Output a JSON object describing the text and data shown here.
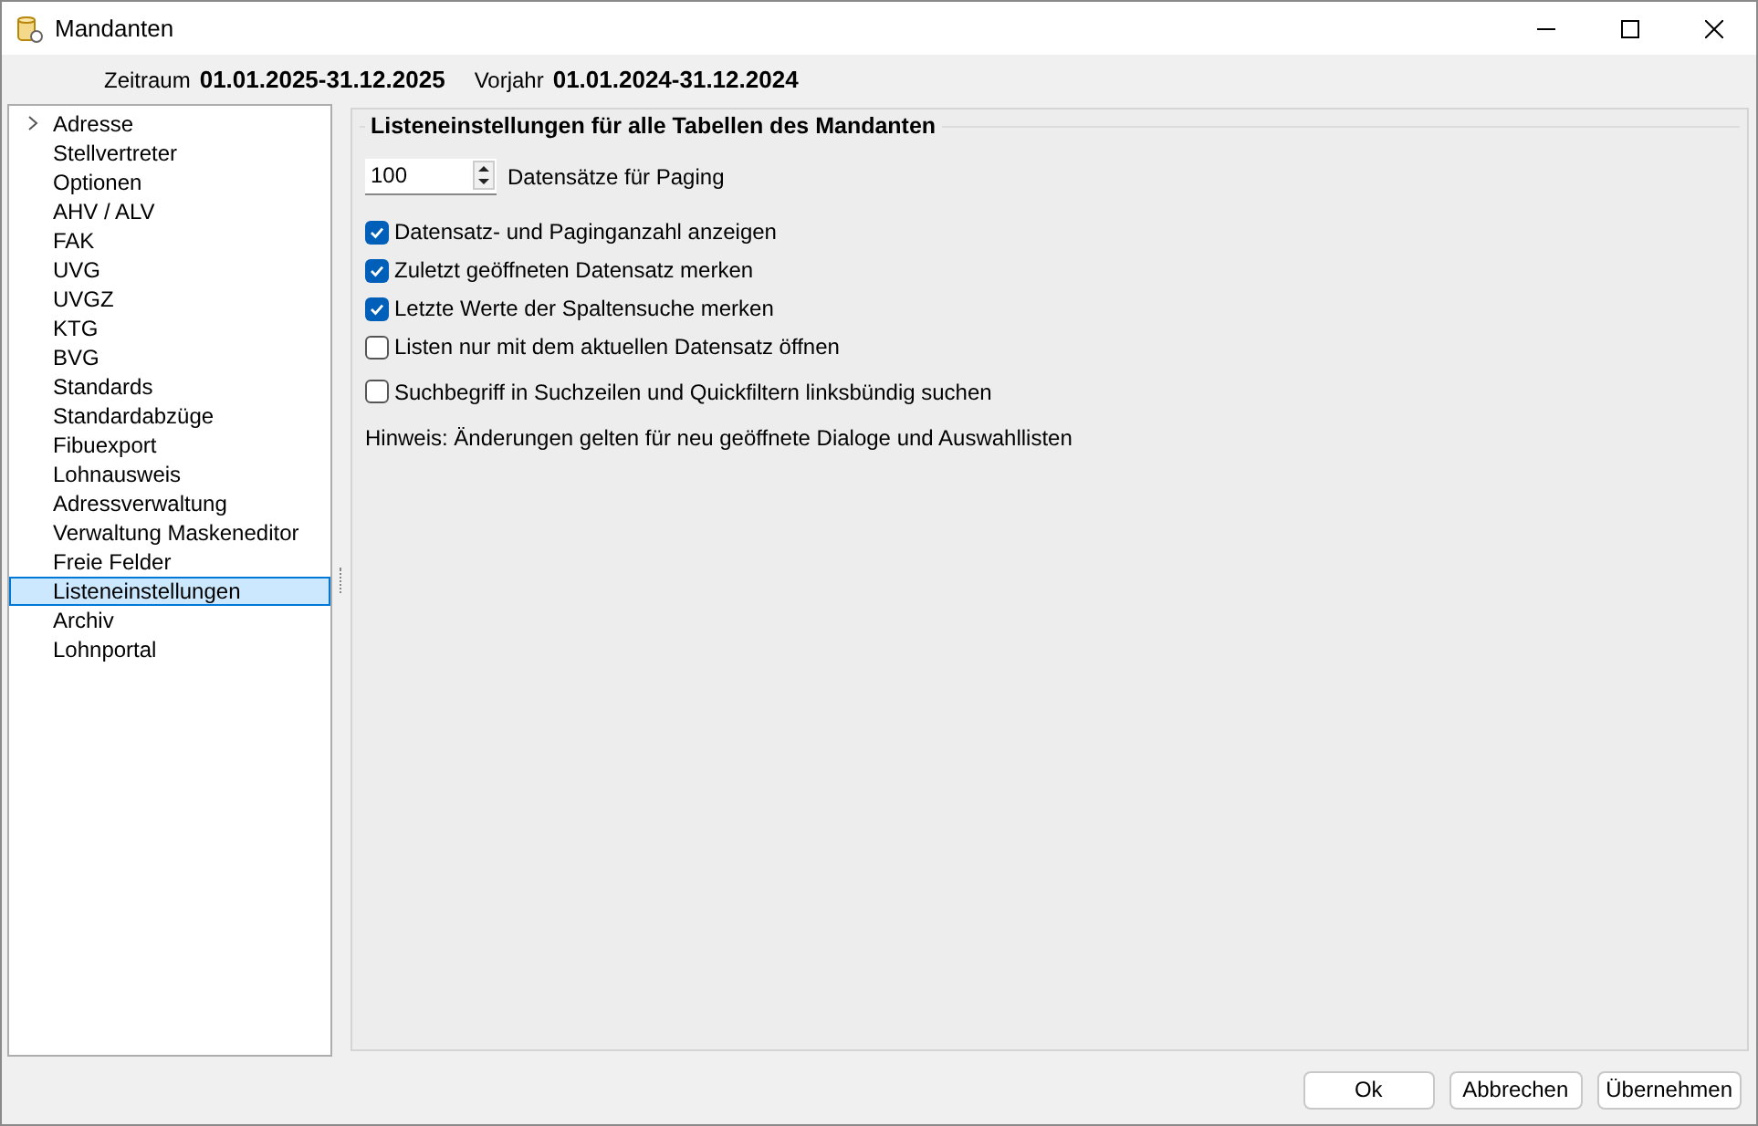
{
  "window": {
    "title": "Mandanten"
  },
  "header": [
    {
      "label": "Zeitraum",
      "value": "01.01.2025-31.12.2025"
    },
    {
      "label": "Vorjahr",
      "value": "01.01.2024-31.12.2024"
    }
  ],
  "tree": [
    {
      "label": "Adresse",
      "expandable": true,
      "selected": false
    },
    {
      "label": "Stellvertreter",
      "expandable": false,
      "selected": false
    },
    {
      "label": "Optionen",
      "expandable": false,
      "selected": false
    },
    {
      "label": "AHV / ALV",
      "expandable": false,
      "selected": false
    },
    {
      "label": "FAK",
      "expandable": false,
      "selected": false
    },
    {
      "label": "UVG",
      "expandable": false,
      "selected": false
    },
    {
      "label": "UVGZ",
      "expandable": false,
      "selected": false
    },
    {
      "label": "KTG",
      "expandable": false,
      "selected": false
    },
    {
      "label": "BVG",
      "expandable": false,
      "selected": false
    },
    {
      "label": "Standards",
      "expandable": false,
      "selected": false
    },
    {
      "label": "Standardabzüge",
      "expandable": false,
      "selected": false
    },
    {
      "label": "Fibuexport",
      "expandable": false,
      "selected": false
    },
    {
      "label": "Lohnausweis",
      "expandable": false,
      "selected": false
    },
    {
      "label": "Adressverwaltung",
      "expandable": false,
      "selected": false
    },
    {
      "label": "Verwaltung Maskeneditor",
      "expandable": false,
      "selected": false
    },
    {
      "label": "Freie Felder",
      "expandable": false,
      "selected": false
    },
    {
      "label": "Listeneinstellungen",
      "expandable": false,
      "selected": true
    },
    {
      "label": "Archiv",
      "expandable": false,
      "selected": false
    },
    {
      "label": "Lohnportal",
      "expandable": false,
      "selected": false
    }
  ],
  "group": {
    "title": "Listeneinstellungen für alle Tabellen des Mandanten",
    "paging": {
      "value": "100",
      "label": "Datensätze für Paging"
    },
    "options": [
      {
        "label": "Datensatz- und Paginganzahl anzeigen",
        "checked": true
      },
      {
        "label": "Zuletzt geöffneten Datensatz merken",
        "checked": true
      },
      {
        "label": "Letzte Werte der Spaltensuche merken",
        "checked": true
      },
      {
        "label": "Listen nur mit dem aktuellen Datensatz öffnen",
        "checked": false
      },
      {
        "label": "Suchbegriff in Suchzeilen und Quickfiltern linksbündig suchen",
        "checked": false
      }
    ],
    "hint": "Hinweis: Änderungen gelten für neu geöffnete Dialoge und Auswahllisten"
  },
  "buttons": [
    "Ok",
    "Abbrechen",
    "Übernehmen"
  ]
}
